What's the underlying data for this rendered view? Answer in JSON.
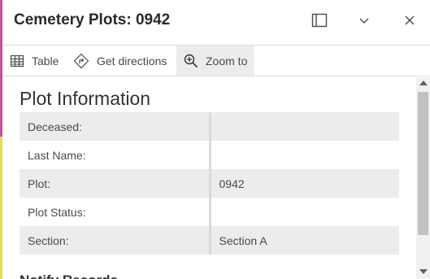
{
  "header": {
    "title": "Cemetery Plots: 0942"
  },
  "icons": {
    "dock": "dock-panel-icon",
    "collapse": "chevron-down-icon",
    "close": "close-icon",
    "table": "table-icon",
    "directions": "directions-icon",
    "zoom": "zoom-in-icon"
  },
  "toolbar": {
    "table_label": "Table",
    "directions_label": "Get directions",
    "zoom_label": "Zoom to"
  },
  "section": {
    "title": "Plot Information",
    "rows": [
      {
        "label": "Deceased:",
        "value": ""
      },
      {
        "label": "Last Name:",
        "value": ""
      },
      {
        "label": "Plot:",
        "value": "0942"
      },
      {
        "label": "Plot Status:",
        "value": ""
      },
      {
        "label": "Section:",
        "value": "Section A"
      }
    ]
  },
  "next_section": {
    "title": "Notify Records"
  },
  "colors": {
    "row_shade": "#ececec",
    "map_pink": "#c94f9a",
    "map_yellow": "#e3e04e"
  }
}
